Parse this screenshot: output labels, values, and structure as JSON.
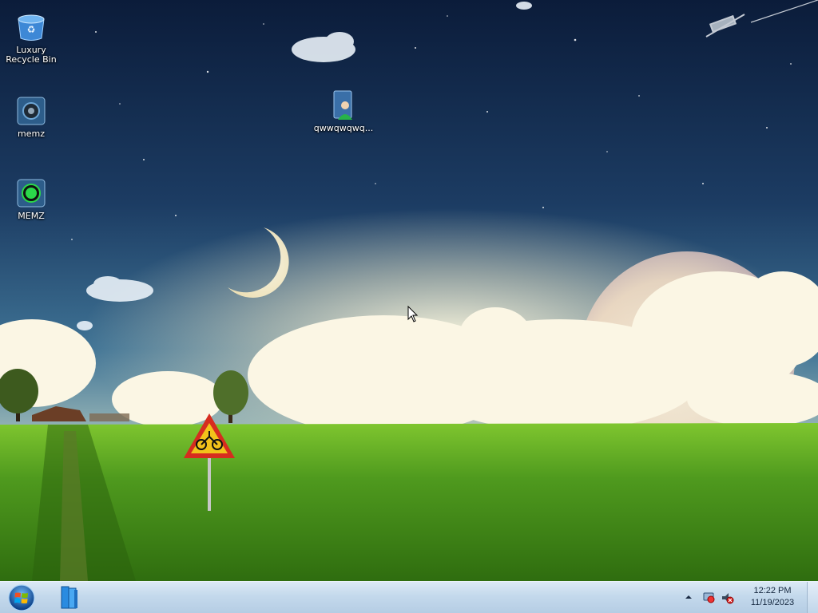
{
  "desktop": {
    "icons": [
      {
        "label": "Luxury Recycle Bin",
        "icon": "recycle-bin-icon"
      },
      {
        "label": "memz",
        "icon": "memz-app-icon"
      },
      {
        "label": "MEMZ",
        "icon": "memz-green-app-icon"
      },
      {
        "label": "qwwqwqwq...",
        "icon": "user-document-icon"
      }
    ]
  },
  "taskbar": {
    "start_icon": "windows-logo-icon",
    "pinned_app_icon": "library-folder-icon",
    "tray_icons": [
      "show-hidden-icons-arrow",
      "network-icon",
      "volume-icon"
    ],
    "clock": {
      "time": "12:22 PM",
      "date": "11/19/2023"
    }
  },
  "colors": {
    "taskbar": "#c4d9ec",
    "sky_top": "#0c1f3e",
    "grass": "#4f9a1e"
  }
}
